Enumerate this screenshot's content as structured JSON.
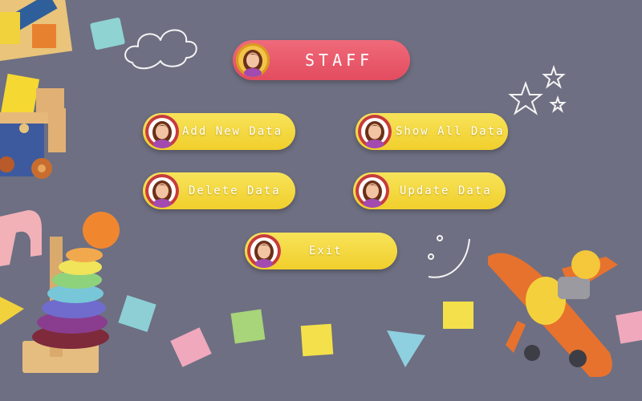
{
  "header": {
    "title": "STAFF",
    "avatar_icon": "staff-avatar-icon"
  },
  "menu": {
    "add_new": "Add New Data",
    "show_all": "Show All Data",
    "delete": "Delete Data",
    "update": "Update Data",
    "exit": "Exit"
  },
  "colors": {
    "background": "#6e6f82",
    "title_pill": "#e85467",
    "button_pill": "#f3d73f",
    "avatar_ring": "#c83b3b"
  },
  "decor": {
    "icons": [
      "cloud-doodle-icon",
      "stars-doodle-icon",
      "smiley-doodle-icon",
      "toy-train-icon",
      "stacking-rings-icon",
      "toy-plane-icon",
      "toy-blocks-icon"
    ]
  }
}
